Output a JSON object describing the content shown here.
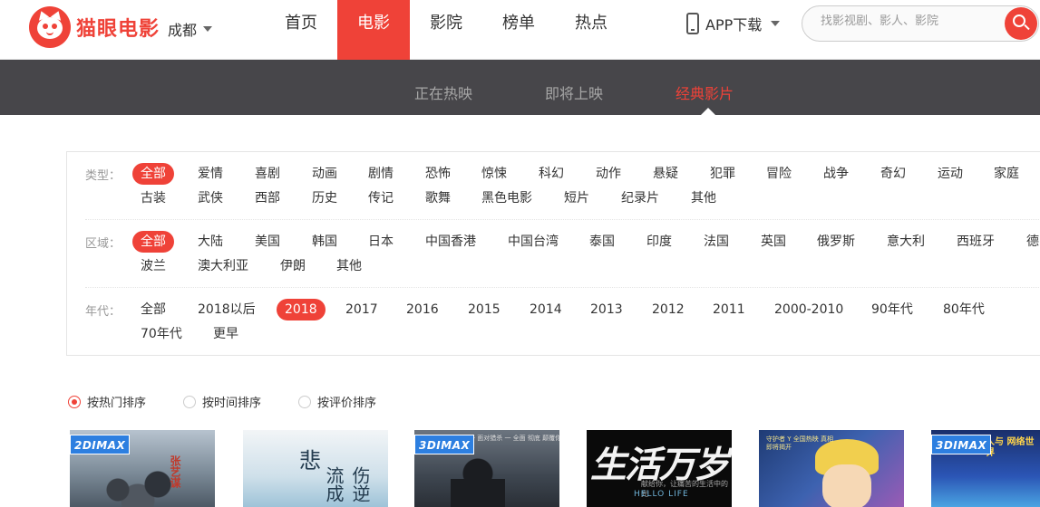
{
  "header": {
    "logo_text": "猫眼电影",
    "city": "成都",
    "nav": [
      "首页",
      "电影",
      "影院",
      "榜单",
      "热点"
    ],
    "nav_active": "电影",
    "app_download": "APP下载",
    "search_placeholder": "找影视剧、影人、影院"
  },
  "subnav": {
    "items": [
      "正在热映",
      "即将上映",
      "经典影片"
    ],
    "active": "经典影片"
  },
  "filters": {
    "type": {
      "label": "类型：",
      "tags": [
        "全部",
        "爱情",
        "喜剧",
        "动画",
        "剧情",
        "恐怖",
        "惊悚",
        "科幻",
        "动作",
        "悬疑",
        "犯罪",
        "冒险",
        "战争",
        "奇幻",
        "运动",
        "家庭",
        "古装",
        "武侠",
        "西部",
        "历史",
        "传记",
        "歌舞",
        "黑色电影",
        "短片",
        "纪录片",
        "其他"
      ],
      "selected": "全部"
    },
    "region": {
      "label": "区域：",
      "tags": [
        "全部",
        "大陆",
        "美国",
        "韩国",
        "日本",
        "中国香港",
        "中国台湾",
        "泰国",
        "印度",
        "法国",
        "英国",
        "俄罗斯",
        "意大利",
        "西班牙",
        "德国",
        "波兰",
        "澳大利亚",
        "伊朗",
        "其他"
      ],
      "selected": "全部"
    },
    "year": {
      "label": "年代：",
      "tags": [
        "全部",
        "2018以后",
        "2018",
        "2017",
        "2016",
        "2015",
        "2014",
        "2013",
        "2012",
        "2011",
        "2000-2010",
        "90年代",
        "80年代",
        "70年代",
        "更早"
      ],
      "selected": "2018"
    }
  },
  "sort": {
    "options": [
      "按热门排序",
      "按时间排序",
      "按评价排序"
    ],
    "selected": "按热门排序"
  },
  "movies": [
    {
      "badge": "2DIMAX",
      "poster_text": "张艺谋"
    },
    {
      "badge": "",
      "poster_text_1": "悲",
      "poster_text_2": "伤逆流成"
    },
    {
      "badge": "3DIMAX",
      "poster_text": "一 面对猎杀 一 全面 彻底 颠覆你的视觉想象"
    },
    {
      "badge": "",
      "poster_text": "生活万岁",
      "poster_sub": "献给你，让痛苦的生活中的光",
      "poster_eng": "HELLO LIFE"
    },
    {
      "badge": "",
      "poster_text": "守护者 Y 全国热映 真相 即将揭开"
    },
    {
      "badge": "3DIMAX",
      "poster_text": "人与 网络世界"
    }
  ],
  "colors": {
    "brand_red": "#ef4238",
    "subnav_bg": "#47464a",
    "imax_blue": "#2d7fe0"
  }
}
